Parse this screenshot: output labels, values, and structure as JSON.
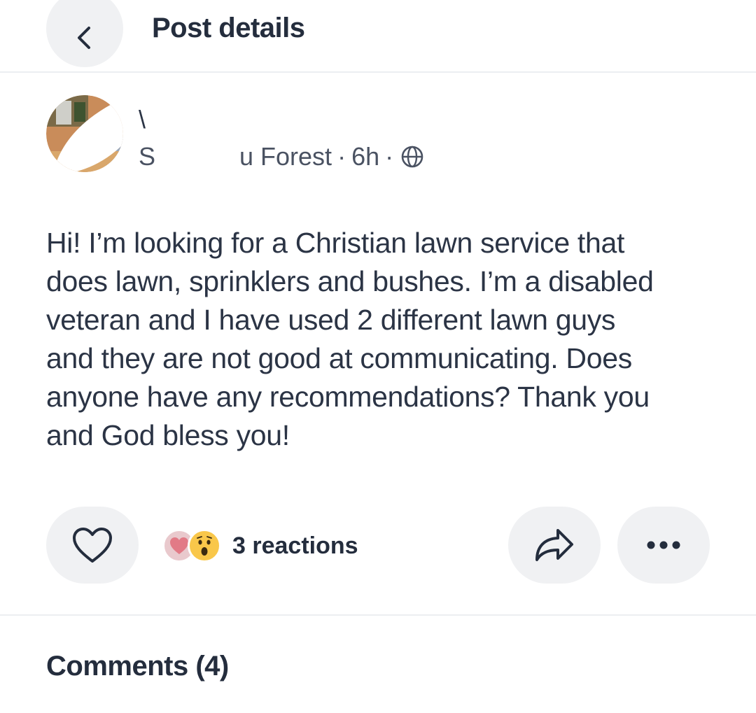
{
  "header": {
    "title": "Post details",
    "back_icon": "chevron-left-icon"
  },
  "author": {
    "name": "\\",
    "meta_prefix": "S",
    "meta_location": "u Forest",
    "meta_time": "6h",
    "separator": "·",
    "visibility_icon": "globe-icon"
  },
  "post": {
    "lines": [
      "Hi! I’m looking for a Christian lawn service that",
      "does lawn, sprinklers and bushes. I’m a disabled",
      "veteran and I have used 2 different lawn guys",
      "and they are not good at communicating. Does",
      "anyone have any recommendations? Thank you",
      "and God bless you!"
    ]
  },
  "actions": {
    "like_icon": "heart-outline-icon",
    "reactions_label": "3 reactions",
    "reaction_icons": [
      "heart-reaction-icon",
      "wow-reaction-icon"
    ],
    "share_icon": "share-arrow-icon",
    "more_icon": "more-dots-icon"
  },
  "comments": {
    "heading": "Comments (4)"
  },
  "colors": {
    "text": "#2b3445",
    "button_bg": "#f0f1f3",
    "divider": "#eceef1"
  }
}
